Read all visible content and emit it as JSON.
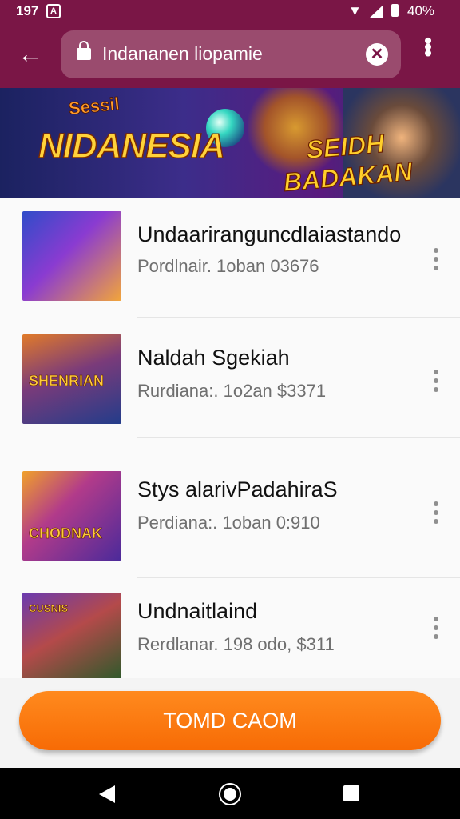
{
  "status_bar": {
    "time": "197",
    "battery_pct": "40%"
  },
  "toolbar": {
    "url": "Indananen liopamie"
  },
  "banner": {
    "title": "NIDANESIA",
    "subtitle": "Sessil",
    "right_text": "SEIDH BADAKAN"
  },
  "list": {
    "items": [
      {
        "title": "Undaariranguncdlaiastando",
        "meta": "Pordlnair. 1oban 03676",
        "thumb_caption": ""
      },
      {
        "title": "Naldah Sgekiah",
        "meta": "Rurdiana:. 1o2an $3371",
        "thumb_caption": "SHENRIAN"
      },
      {
        "title": "Stys alarivPadahiraS",
        "meta": "Perdiana:. 1oban 0:910",
        "thumb_caption": "CHODNAK"
      },
      {
        "title": "Undnaitlaind",
        "meta": "Rerdlanar. 198 odo, $311",
        "thumb_caption": "CUSNIS"
      }
    ]
  },
  "cta": {
    "label": "TOMD CAOM"
  },
  "colors": {
    "brand": "#7a1646",
    "accent": "#f76b05"
  }
}
